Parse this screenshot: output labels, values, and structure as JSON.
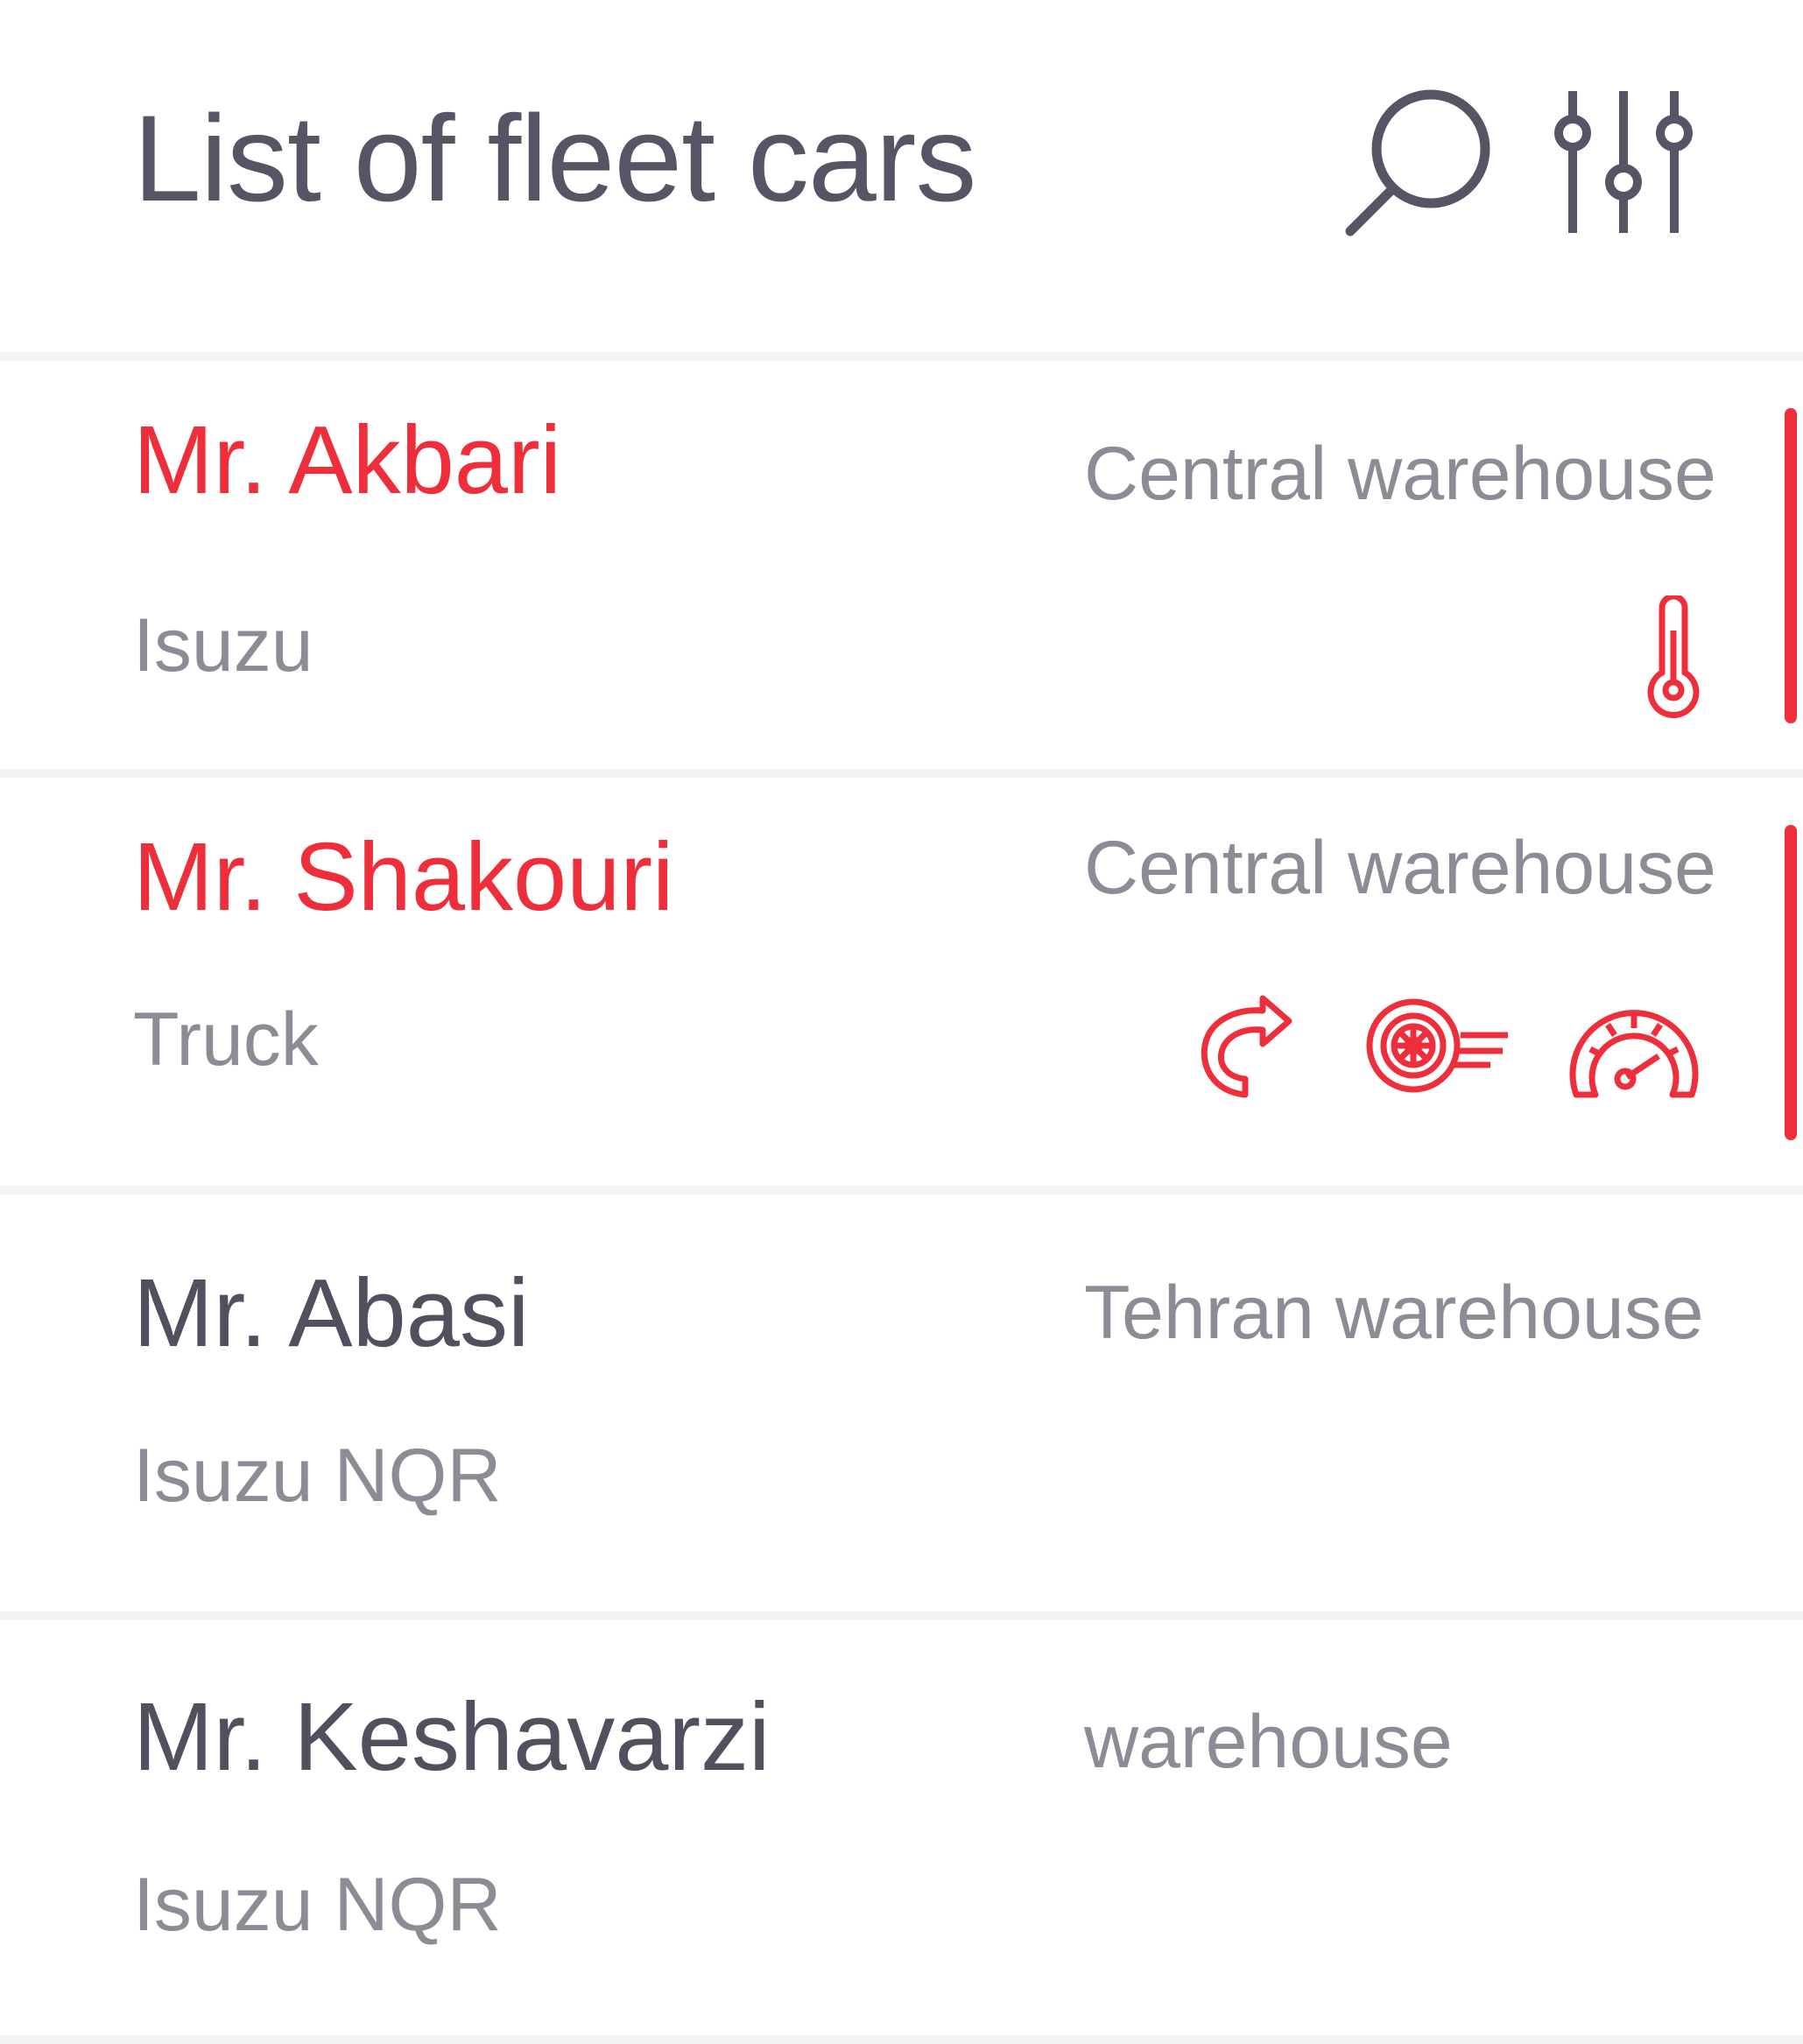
{
  "header": {
    "title": "List of fleet cars"
  },
  "colors": {
    "alert": "#ee2f3b",
    "name": "#50505e",
    "secondary": "#8c8c96"
  },
  "cars": [
    {
      "name": "Mr. Akbari",
      "warehouse": "Central warehouse",
      "vehicle": "Isuzu",
      "alert": true,
      "status_icons": [
        "thermometer-icon"
      ]
    },
    {
      "name": "Mr. Shakouri",
      "warehouse": "Central warehouse",
      "vehicle": "Truck",
      "alert": true,
      "status_icons": [
        "turn-arrow-icon",
        "tire-speed-icon",
        "speedometer-icon"
      ]
    },
    {
      "name": "Mr. Abasi",
      "warehouse": "Tehran warehouse",
      "vehicle": "Isuzu NQR",
      "alert": false,
      "status_icons": []
    },
    {
      "name": "Mr. Keshavarzi",
      "warehouse": "warehouse",
      "vehicle": "Isuzu NQR",
      "alert": false,
      "status_icons": []
    }
  ]
}
